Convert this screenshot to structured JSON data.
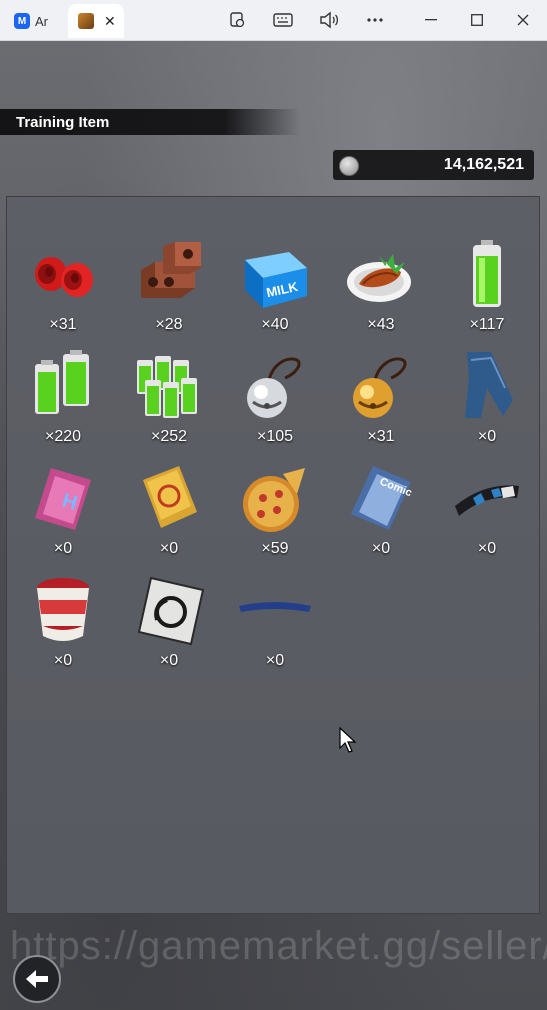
{
  "browser": {
    "tabs": [
      {
        "label": "Ar",
        "icon": "app-icon"
      },
      {
        "label": "",
        "icon": "game-icon",
        "close": "✕"
      }
    ],
    "controls": [
      "screenshot-icon",
      "keyboard-icon",
      "volume-icon",
      "more-icon",
      "minimize-icon",
      "maximize-icon",
      "close-icon"
    ]
  },
  "screen": {
    "title": "Training Item",
    "currency": {
      "icon": "coin-icon",
      "value": "14,162,521"
    },
    "items": [
      {
        "name": "dumbbell",
        "count": "×31"
      },
      {
        "name": "bricks",
        "count": "×28"
      },
      {
        "name": "milk-carton",
        "count": "×40"
      },
      {
        "name": "grilled-meat",
        "count": "×43"
      },
      {
        "name": "battery",
        "count": "×117"
      },
      {
        "name": "battery-pack",
        "count": "×220"
      },
      {
        "name": "battery-crate",
        "count": "×252"
      },
      {
        "name": "silver-bell",
        "count": "×105"
      },
      {
        "name": "gold-bell",
        "count": "×31"
      },
      {
        "name": "jeans",
        "count": "×0"
      },
      {
        "name": "magazine-pink",
        "count": "×0"
      },
      {
        "name": "book-yellow",
        "count": "×0"
      },
      {
        "name": "pizza",
        "count": "×59"
      },
      {
        "name": "comic-book",
        "count": "×0"
      },
      {
        "name": "headband",
        "count": "×0"
      },
      {
        "name": "cup-noodle",
        "count": "×0"
      },
      {
        "name": "sticker-card",
        "count": "×0"
      },
      {
        "name": "blue-band",
        "count": "×0"
      }
    ],
    "watermark": "https://gamemarket.gg/seller/",
    "back_label": "back"
  }
}
